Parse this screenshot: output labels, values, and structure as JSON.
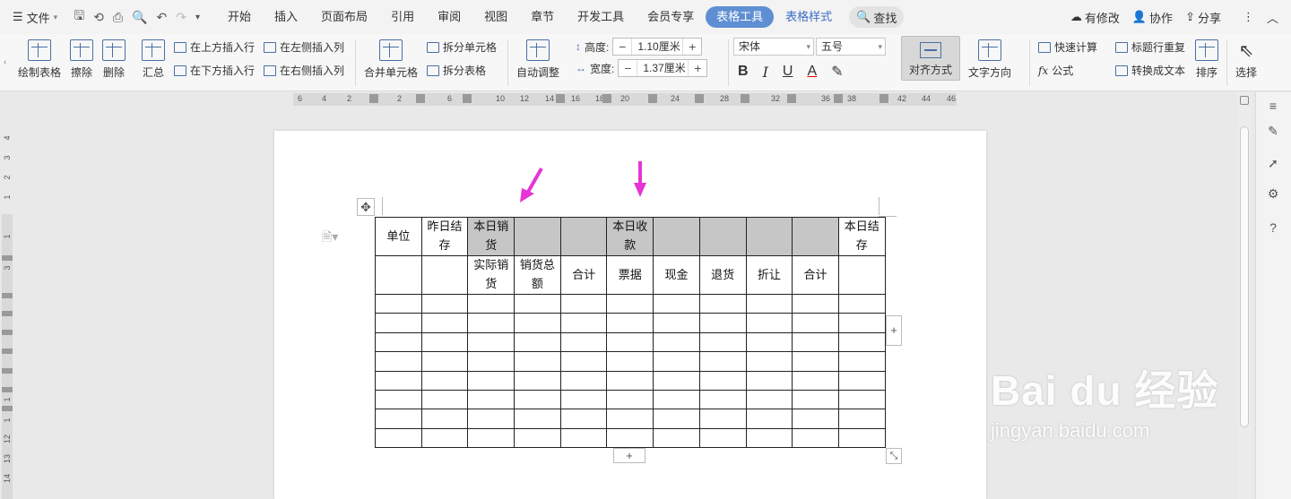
{
  "menubar": {
    "file_label": "文件",
    "tabs": [
      {
        "label": "开始"
      },
      {
        "label": "插入"
      },
      {
        "label": "页面布局"
      },
      {
        "label": "引用"
      },
      {
        "label": "审阅"
      },
      {
        "label": "视图"
      },
      {
        "label": "章节"
      },
      {
        "label": "开发工具"
      },
      {
        "label": "会员专享"
      },
      {
        "label": "表格工具"
      },
      {
        "label": "表格样式"
      }
    ],
    "search_label": "查找",
    "right": {
      "modified": "有修改",
      "collab": "协作",
      "share": "分享"
    }
  },
  "ribbon": {
    "draw_table": "绘制表格",
    "erase": "擦除",
    "delete": "删除",
    "summary": "汇总",
    "insert_above": "在上方插入行",
    "insert_below": "在下方插入行",
    "insert_left": "在左侧插入列",
    "insert_right": "在右侧插入列",
    "merge_cells": "合并单元格",
    "split_cells": "拆分单元格",
    "split_table": "拆分表格",
    "auto_adjust": "自动调整",
    "height_label": "高度:",
    "height_value": "1.10厘米",
    "width_label": "宽度:",
    "width_value": "1.37厘米",
    "font_name": "宋体",
    "font_size": "五号",
    "align": "对齐方式",
    "text_direction": "文字方向",
    "quick_calc": "快速计算",
    "formula": "公式",
    "repeat_header": "标题行重复",
    "convert_text": "转换成文本",
    "sort": "排序",
    "select": "选择"
  },
  "ruler": {
    "numbers": [
      "6",
      "4",
      "2",
      "2",
      "6",
      "10",
      "12",
      "14",
      "16",
      "18",
      "20",
      "22",
      "24",
      "26",
      "28",
      "30",
      "32",
      "34",
      "36",
      "38",
      "40",
      "42",
      "44",
      "46"
    ]
  },
  "vruler": {
    "numbers": [
      "4",
      "3",
      "2",
      "1",
      "1",
      "2",
      "3",
      "1",
      "2",
      "4",
      "5",
      "6",
      "7",
      "8",
      "9",
      "10",
      "11",
      "12",
      "13",
      "14"
    ]
  },
  "table": {
    "header_row1": [
      "单位",
      "昨日结存",
      "本日销货",
      "",
      "",
      "本日收款",
      "",
      "",
      "",
      "",
      "本日结存"
    ],
    "header_row2": [
      "",
      "",
      "实际销货",
      "销货总额",
      "合计",
      "票据",
      "现金",
      "退货",
      "折让",
      "合计",
      ""
    ],
    "empty_rows": 8
  },
  "watermark": {
    "main": "Bai du 经验",
    "sub": "jingyan.baidu.com"
  },
  "colors": {
    "accent": "#5f8fd3",
    "arrow": "#e535d6",
    "shade": "#c6c6c6"
  }
}
